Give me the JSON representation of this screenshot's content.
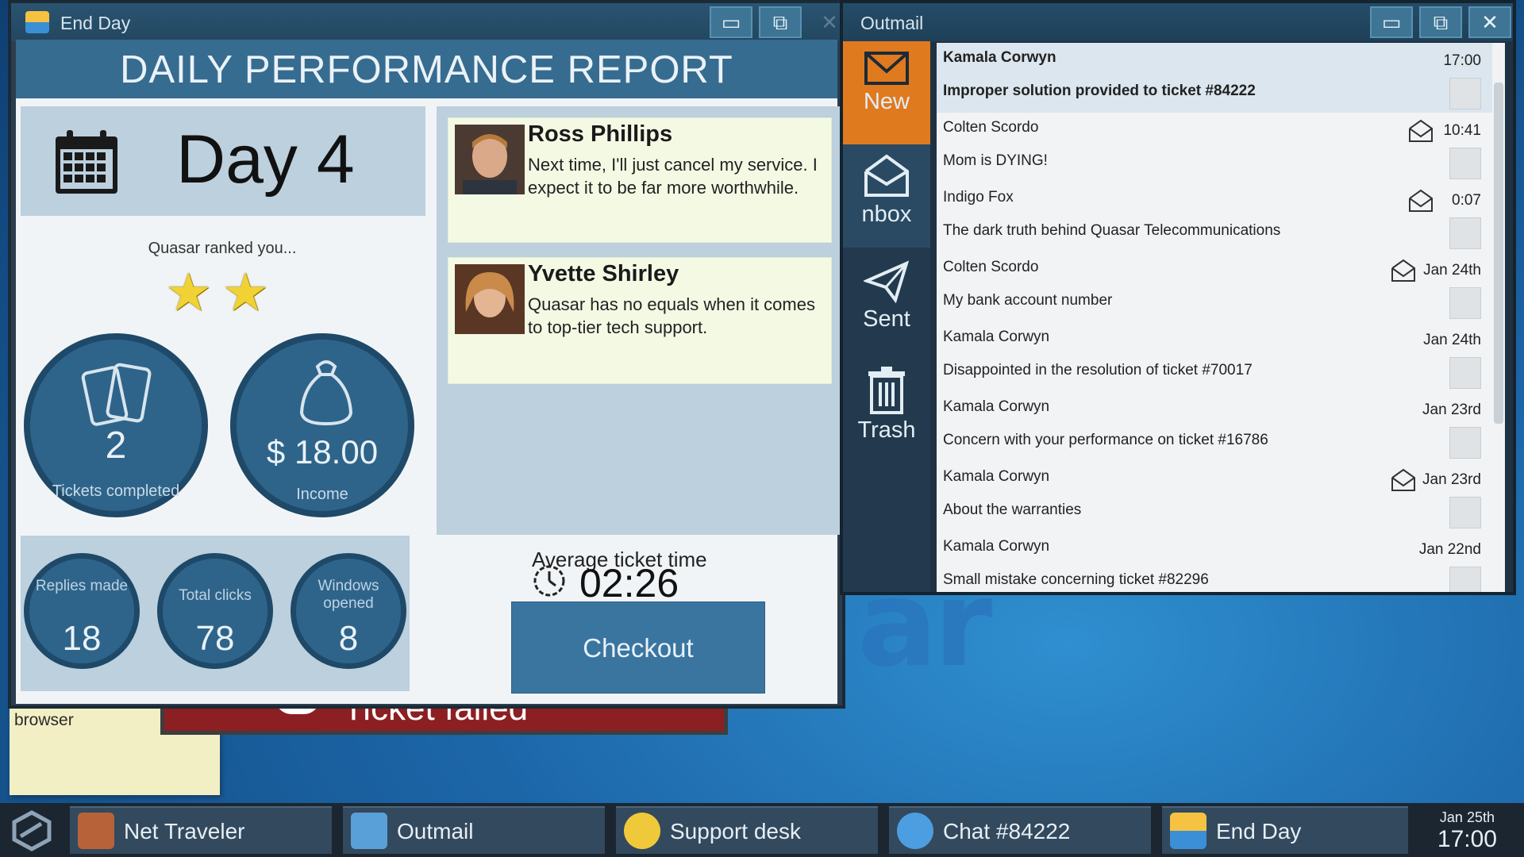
{
  "background": {
    "sticky_note": "browser",
    "ticket_window_text": "Ticket failed"
  },
  "endday_window": {
    "title": "End Day",
    "header": "DAILY PERFORMANCE REPORT",
    "day_label": "Day 4",
    "rank_text": "Quasar ranked you...",
    "stars": 2,
    "stars_max": 5,
    "tickets": {
      "value": "2",
      "label": "Tickets completed"
    },
    "income": {
      "value": "$ 18.00",
      "label": "Income"
    },
    "stats": [
      {
        "label": "Replies made",
        "value": "18"
      },
      {
        "label": "Total clicks",
        "value": "78"
      },
      {
        "label": "Windows opened",
        "value": "8"
      }
    ],
    "reviews": [
      {
        "name": "Ross Phillips",
        "text": "Next time, I'll just cancel my service. I expect it to be far more worthwhile."
      },
      {
        "name": "Yvette Shirley",
        "text": "Quasar has no equals when it comes to top-tier tech support."
      }
    ],
    "avg_ticket_label": "Average ticket time",
    "avg_ticket_value": "02:26",
    "checkout_label": "Checkout"
  },
  "outmail_window": {
    "title": "Outmail",
    "sidebar": [
      {
        "label": "New",
        "icon": "envelope-closed-icon"
      },
      {
        "label": "nbox",
        "icon": "envelope-open-icon"
      },
      {
        "label": "Sent",
        "icon": "paper-plane-icon"
      },
      {
        "label": "Trash",
        "icon": "trash-can-icon"
      }
    ],
    "messages": [
      {
        "sender": "Kamala Corwyn",
        "subject": "Improper solution provided to ticket #84222",
        "time": "17:00",
        "replied": false,
        "selected": true
      },
      {
        "sender": "Colten Scordo",
        "subject": "Mom is DYING!",
        "time": "10:41",
        "replied": true,
        "selected": false
      },
      {
        "sender": "Indigo Fox",
        "subject": "The dark truth behind Quasar Telecommunications",
        "time": "0:07",
        "replied": true,
        "selected": false
      },
      {
        "sender": "Colten Scordo",
        "subject": "My bank account number",
        "time": "Jan 24th",
        "replied": true,
        "selected": false
      },
      {
        "sender": "Kamala Corwyn",
        "subject": "Disappointed in the resolution of ticket #70017",
        "time": "Jan 24th",
        "replied": false,
        "selected": false
      },
      {
        "sender": "Kamala Corwyn",
        "subject": "Concern with your performance on ticket #16786",
        "time": "Jan 23rd",
        "replied": false,
        "selected": false
      },
      {
        "sender": "Kamala Corwyn",
        "subject": "About the warranties",
        "time": "Jan 23rd",
        "replied": true,
        "selected": false
      },
      {
        "sender": "Kamala Corwyn",
        "subject": "Small mistake concerning ticket #82296",
        "time": "Jan 22nd",
        "replied": false,
        "selected": false
      }
    ]
  },
  "taskbar": {
    "items": [
      {
        "label": "Net Traveler",
        "icon": "fox-browser-icon",
        "color": "#b8623a"
      },
      {
        "label": "Outmail",
        "icon": "mail-app-icon",
        "color": "#5aa0d8"
      },
      {
        "label": "Support desk",
        "icon": "lightbulb-icon",
        "color": "#f0c93a"
      },
      {
        "label": "Chat #84222",
        "icon": "chat-bubbles-icon",
        "color": "#4c9ee0"
      },
      {
        "label": "End Day",
        "icon": "sunset-icon",
        "color": "#f5c242"
      }
    ],
    "clock": {
      "date": "Jan 25th",
      "time": "17:00"
    }
  }
}
